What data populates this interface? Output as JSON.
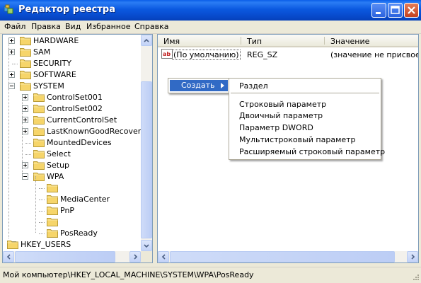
{
  "window": {
    "title": "Редактор реестра"
  },
  "menu": [
    "Файл",
    "Правка",
    "Вид",
    "Избранное",
    "Справка"
  ],
  "tree": {
    "items": [
      {
        "label": "HARDWARE",
        "expander": "+"
      },
      {
        "label": "SAM",
        "expander": "+"
      },
      {
        "label": "SECURITY",
        "expander": ""
      },
      {
        "label": "SOFTWARE",
        "expander": "+"
      },
      {
        "label": "SYSTEM",
        "expander": "-"
      },
      {
        "label": "ControlSet001",
        "expander": "+"
      },
      {
        "label": "ControlSet002",
        "expander": "+"
      },
      {
        "label": "CurrentControlSet",
        "expander": "+"
      },
      {
        "label": "LastKnownGoodRecovery",
        "expander": "+"
      },
      {
        "label": "MountedDevices",
        "expander": ""
      },
      {
        "label": "Select",
        "expander": ""
      },
      {
        "label": "Setup",
        "expander": "+"
      },
      {
        "label": "WPA",
        "expander": "-"
      },
      {
        "label": "",
        "expander": ""
      },
      {
        "label": "MediaCenter",
        "expander": ""
      },
      {
        "label": "PnP",
        "expander": ""
      },
      {
        "label": "",
        "expander": ""
      },
      {
        "label": "PosReady",
        "expander": ""
      },
      {
        "label": "HKEY_USERS",
        "expander": "+"
      }
    ]
  },
  "list": {
    "columns": [
      "Имя",
      "Тип",
      "Значение"
    ],
    "rows": [
      {
        "name": "(По умолчанию)",
        "type": "REG_SZ",
        "value": "(значение не присвоено)"
      }
    ]
  },
  "context_menu": {
    "create_label": "Создать",
    "submenu": [
      "Раздел",
      "Строковый параметр",
      "Двоичный параметр",
      "Параметр DWORD",
      "Мультистроковый параметр",
      "Расширяемый строковый параметр"
    ]
  },
  "status": {
    "path": "Мой компьютер\\HKEY_LOCAL_MACHINE\\SYSTEM\\WPA\\PosReady"
  },
  "colors": {
    "titlebar": "#0b59e0",
    "highlight": "#316ac5",
    "folder": "#f6d56a"
  },
  "icons": [
    "regedit-app-icon",
    "minimize-icon",
    "maximize-icon",
    "close-icon",
    "folder-icon",
    "string-value-icon",
    "submenu-arrow-icon",
    "size-grip-icon"
  ]
}
